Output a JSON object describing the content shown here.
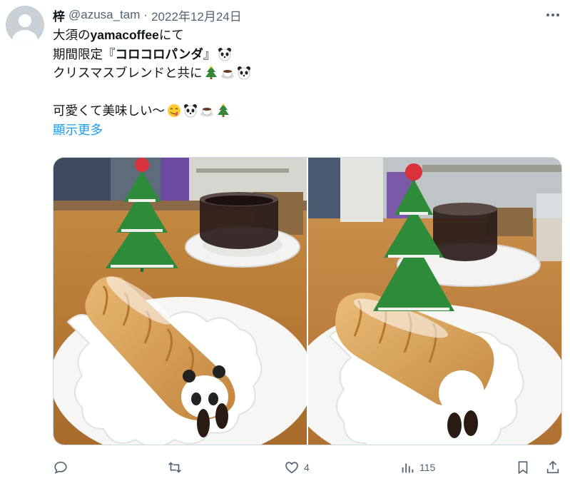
{
  "tweet": {
    "display_name": "梓",
    "handle": "@azusa_tam",
    "separator": "·",
    "date": "2022年12月24日",
    "text": {
      "line1_pre": "大須の",
      "line1_bold": "yamacoffee",
      "line1_post": "にて",
      "line2_pre": "期間限定『",
      "line2_bold": "コロコロパンダ",
      "line2_post": "』",
      "line3": "クリスマスブレンドと共に",
      "line4": "可愛くて美味しい〜",
      "show_more": "顯示更多"
    },
    "images": [
      {
        "description": "panda cream roll with christmas tree and coffee"
      },
      {
        "description": "panda cream roll side view with christmas tree"
      }
    ]
  },
  "actions": {
    "reply_count": "",
    "retweet_count": "",
    "like_count": "4",
    "views_count": "115"
  },
  "colors": {
    "text": "#0f1419",
    "secondary": "#536471",
    "link": "#1d9bf0",
    "border": "#cfd9de"
  },
  "icons": [
    "more-icon",
    "panda-emoji",
    "tree-emoji",
    "coffee-emoji",
    "yum-emoji",
    "reply-icon",
    "retweet-icon",
    "like-icon",
    "views-icon",
    "bookmark-icon",
    "share-icon"
  ]
}
